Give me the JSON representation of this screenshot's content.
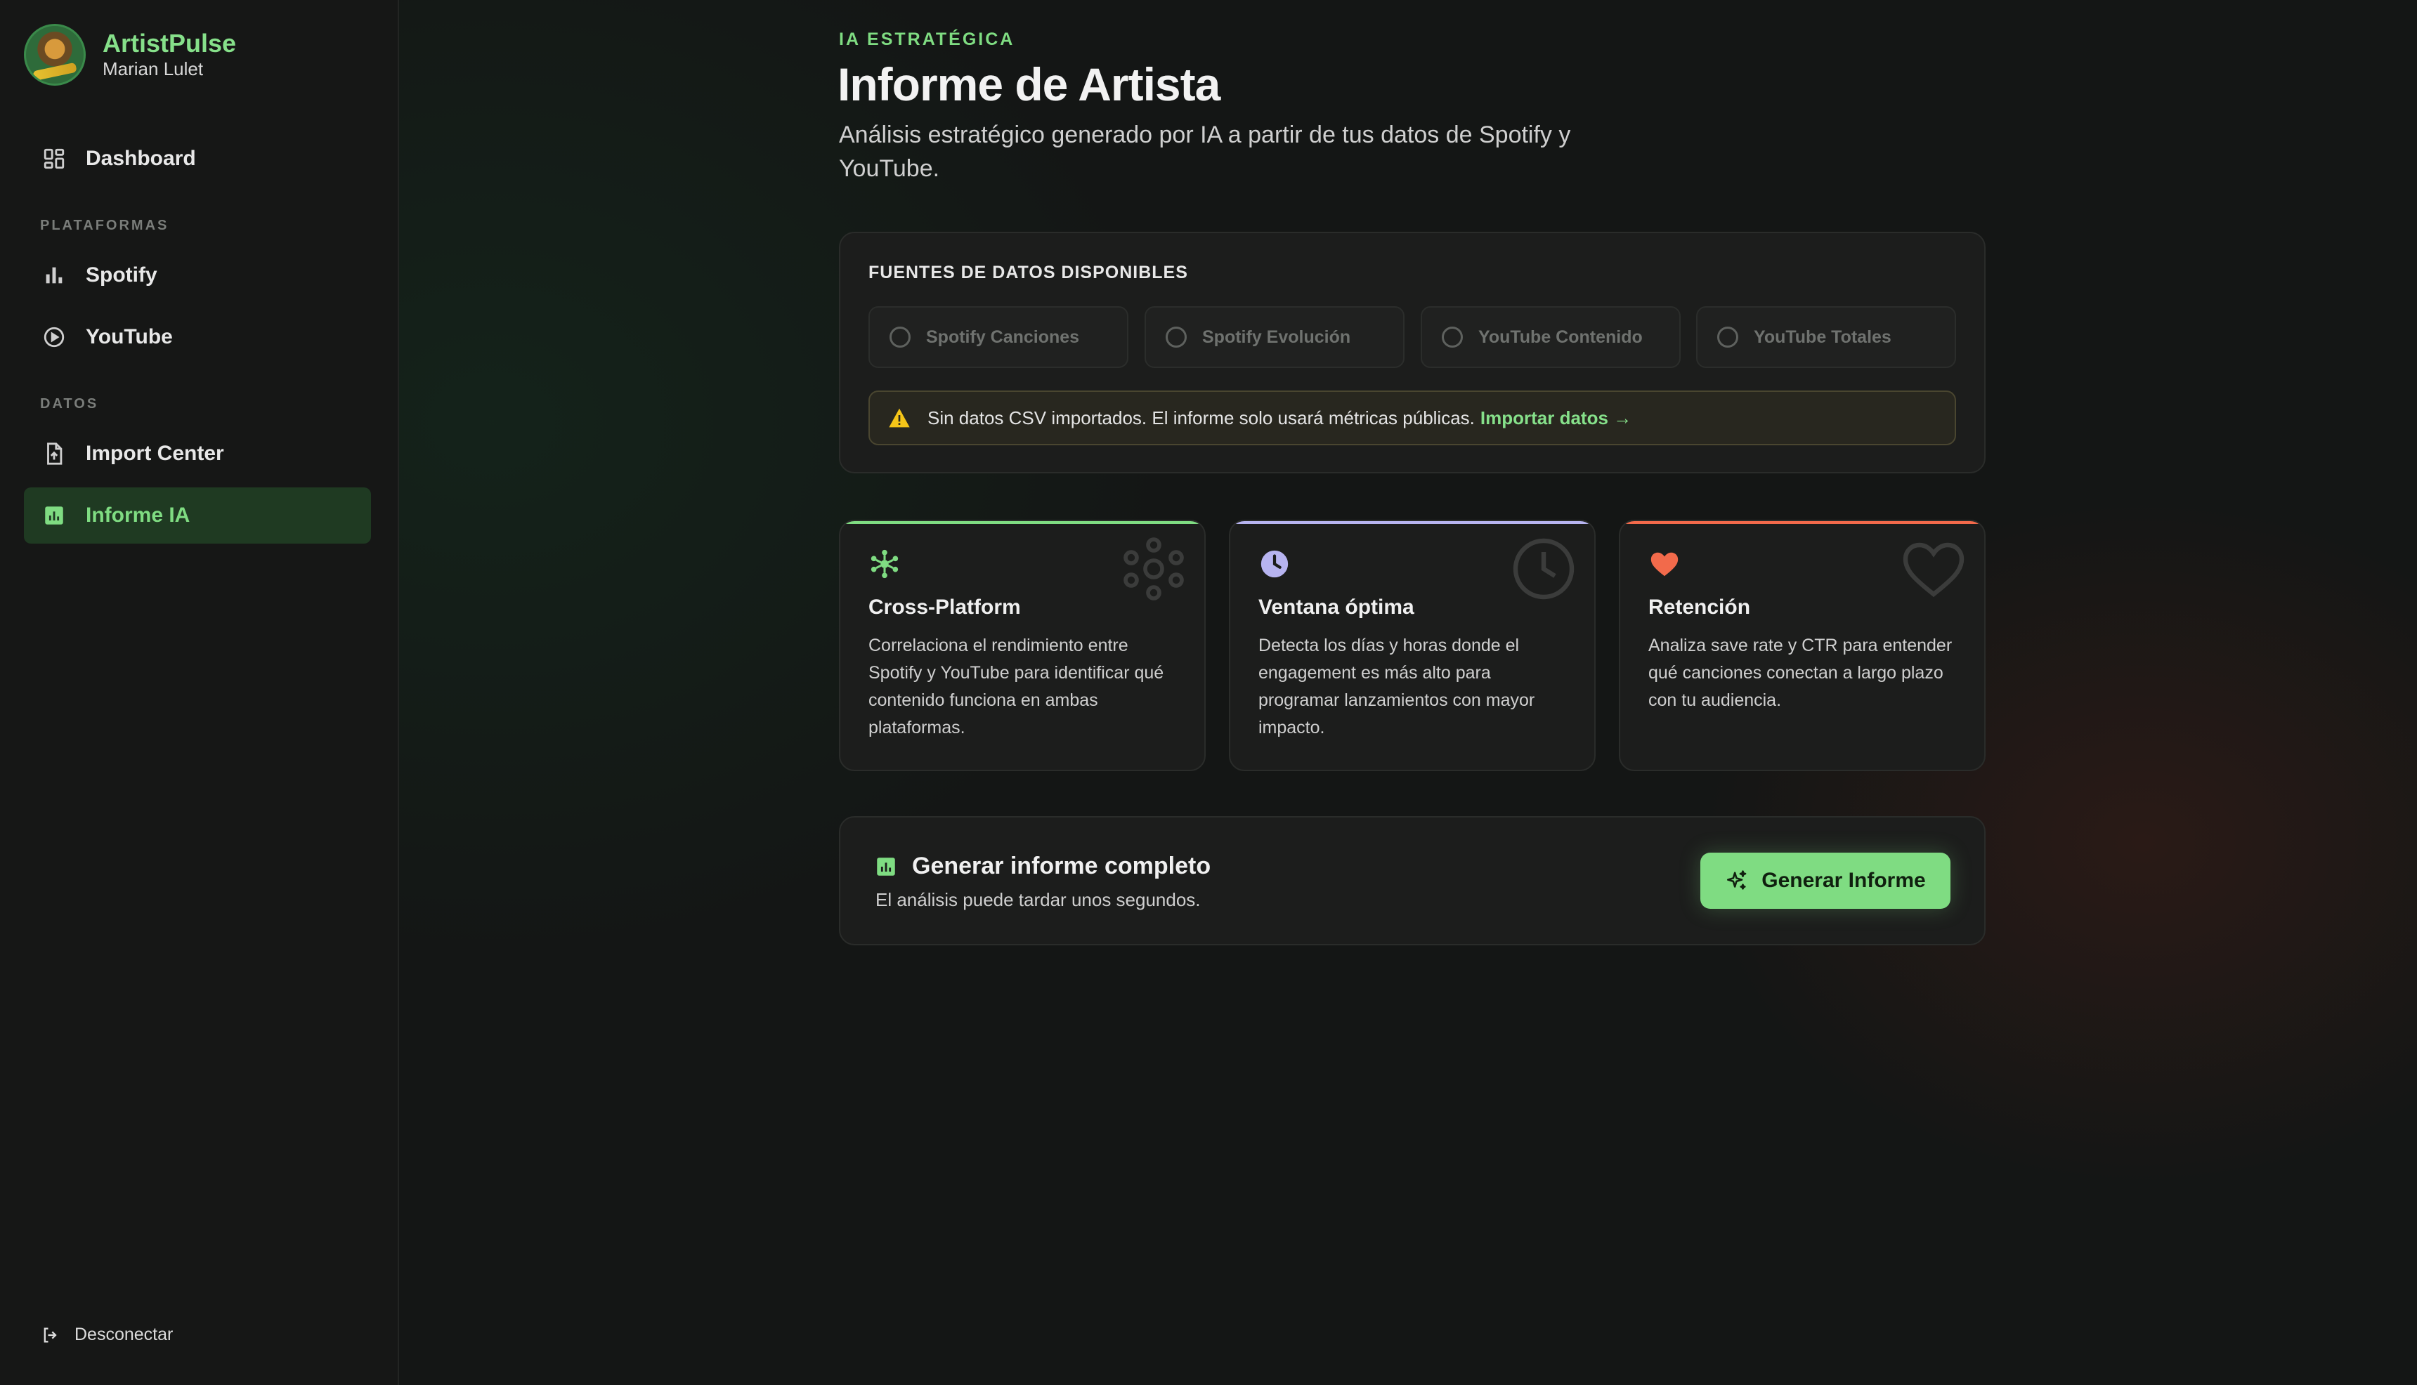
{
  "app": {
    "name": "ArtistPulse",
    "user": "Marian Lulet"
  },
  "sidebar": {
    "dashboard": "Dashboard",
    "section_platforms": "PLATAFORMAS",
    "spotify": "Spotify",
    "youtube": "YouTube",
    "section_data": "DATOS",
    "import_center": "Import Center",
    "informe_ia": "Informe IA",
    "logout": "Desconectar"
  },
  "header": {
    "eyebrow": "IA ESTRATÉGICA",
    "title": "Informe de Artista",
    "subtitle": "Análisis estratégico generado por IA a partir de tus datos de Spotify y YouTube."
  },
  "sources": {
    "title": "FUENTES DE DATOS DISPONIBLES",
    "items": [
      {
        "label": "Spotify Canciones",
        "selected": false
      },
      {
        "label": "Spotify Evolución",
        "selected": false
      },
      {
        "label": "YouTube Contenido",
        "selected": false
      },
      {
        "label": "YouTube Totales",
        "selected": false
      }
    ],
    "warning_text": "Sin datos CSV importados. El informe solo usará métricas públicas.",
    "warning_link": "Importar datos →"
  },
  "features": [
    {
      "icon": "hub-icon",
      "accent": "#7fdc82",
      "title": "Cross-Platform",
      "description": "Correlaciona el rendimiento entre Spotify y YouTube para identificar qué contenido funciona en ambas plataformas."
    },
    {
      "icon": "clock-icon",
      "accent": "#b7b4f0",
      "title": "Ventana óptima",
      "description": "Detecta los días y horas donde el engagement es más alto para programar lanzamientos con mayor impacto."
    },
    {
      "icon": "heart-icon",
      "accent": "#f26a4b",
      "title": "Retención",
      "description": "Analiza save rate y CTR para entender qué canciones conectan a largo plazo con tu audiencia."
    }
  ],
  "generate": {
    "title": "Generar informe completo",
    "subtitle": "El análisis puede tardar unos segundos.",
    "button": "Generar Informe"
  },
  "colors": {
    "accent": "#7fdc82",
    "background": "#141615",
    "panel": "#1c1d1c",
    "warning": "#f5c518"
  }
}
